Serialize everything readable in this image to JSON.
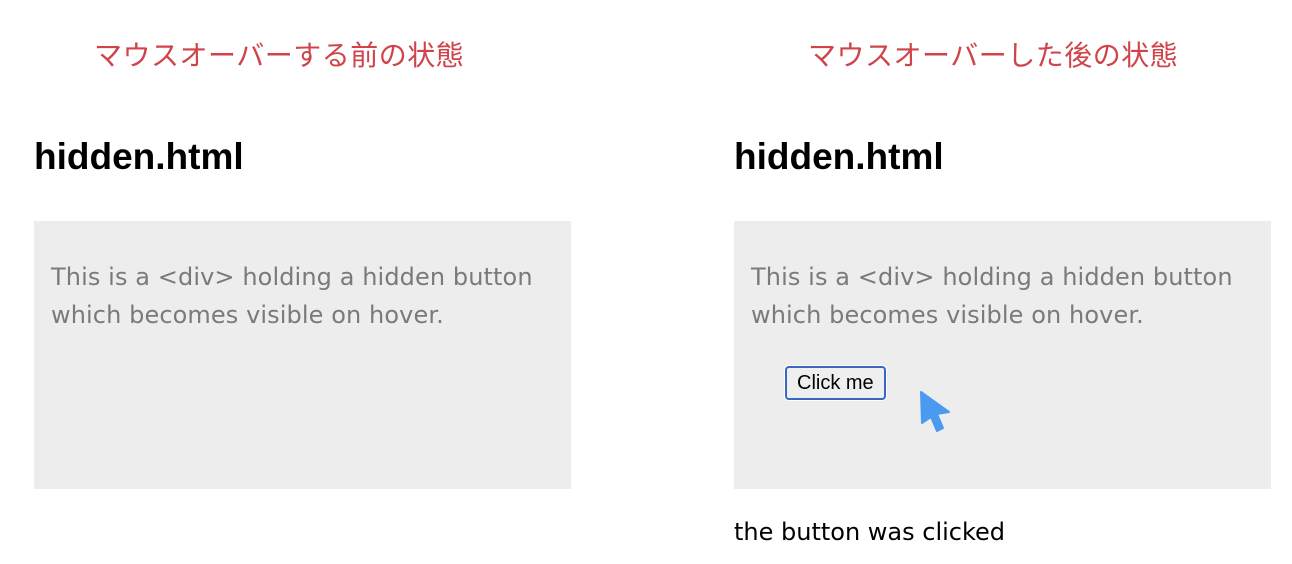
{
  "captions": {
    "before": "マウスオーバーする前の状態",
    "after": "マウスオーバーした後の状態"
  },
  "panels": {
    "before": {
      "title": "hidden.html",
      "box_text_line1": "This is a <div> holding a hidden button",
      "box_text_line2": "which becomes visible on hover."
    },
    "after": {
      "title": "hidden.html",
      "box_text_line1": "This is a <div> holding a hidden button",
      "box_text_line2": "which becomes visible on hover.",
      "button_label": "Click me",
      "result_text": "the button was clicked"
    }
  },
  "colors": {
    "caption": "#d0434a",
    "box_background": "#ededed",
    "box_text": "#7a7a7a",
    "button_border": "#3a66c4",
    "cursor": "#4a9bf0"
  },
  "icons": {
    "cursor": "mouse-pointer-arrow"
  }
}
